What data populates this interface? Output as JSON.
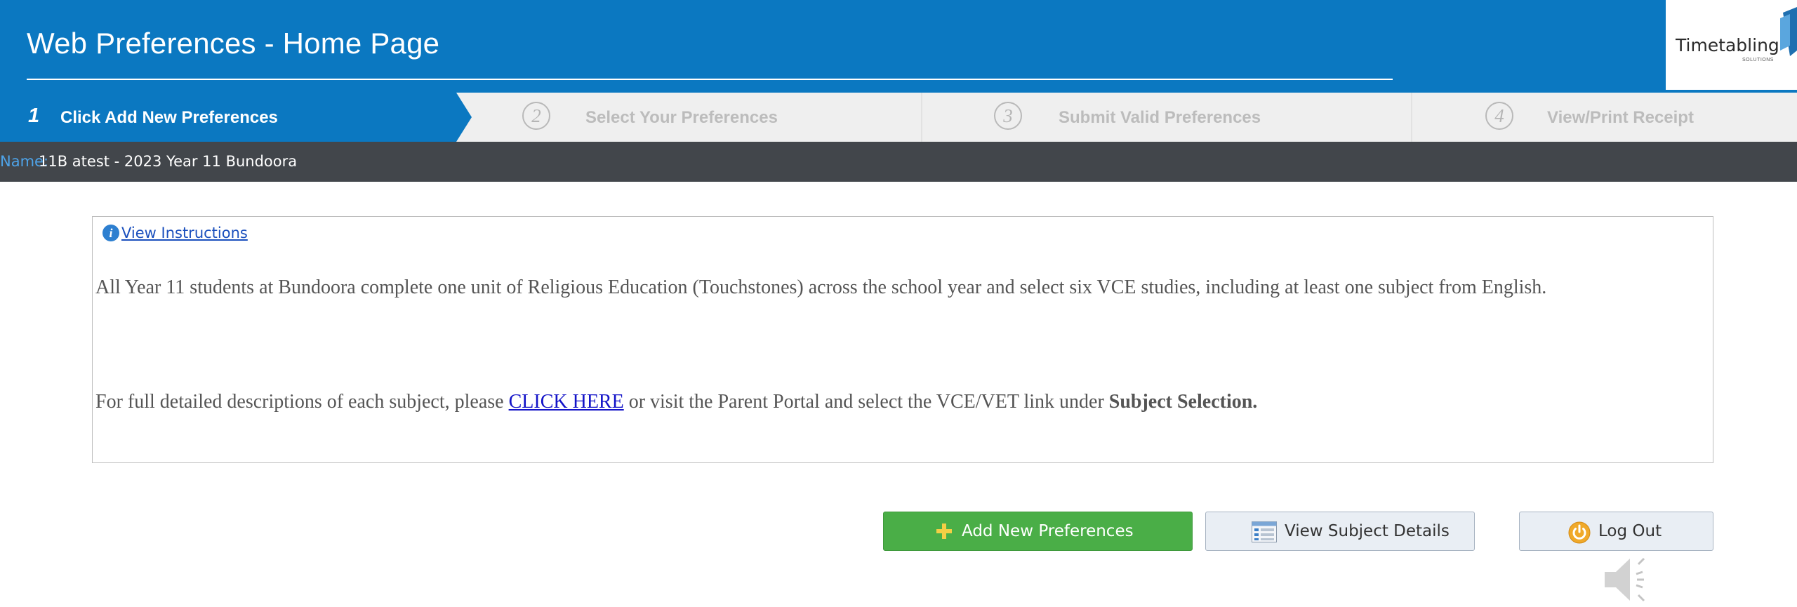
{
  "header": {
    "title": "Web Preferences - Home Page",
    "logo_text": "Timetabling",
    "logo_subtext": "SOLUTIONS",
    "bg_color": "#0b78c1"
  },
  "steps": [
    {
      "number": "1",
      "label": "Click Add New Preferences",
      "active": true
    },
    {
      "number": "2",
      "label": "Select Your Preferences",
      "active": false
    },
    {
      "number": "3",
      "label": "Submit Valid Preferences",
      "active": false
    },
    {
      "number": "4",
      "label": "View/Print Receipt",
      "active": false
    }
  ],
  "namebar": {
    "label": "Name:",
    "value": "11B atest - 2023 Year 11 Bundoora"
  },
  "panel": {
    "instructions_link": "View Instructions",
    "paragraph1": "All Year 11 students at Bundoora complete one unit of Religious Education (Touchstones) across the school year and select six VCE studies, including at least one subject from English.",
    "paragraph2_before": "For full detailed descriptions of each subject, please ",
    "paragraph2_link": "CLICK HERE",
    "paragraph2_middle": " or visit the Parent Portal and select the VCE/VET link under ",
    "paragraph2_bold": "Subject Selection."
  },
  "buttons": {
    "add": "Add New Preferences",
    "details": "View Subject Details",
    "logout": "Log Out"
  },
  "icons": {
    "info": "info-icon",
    "plus": "plus-icon",
    "list": "list-icon",
    "power": "power-icon",
    "speaker": "speaker-icon"
  }
}
